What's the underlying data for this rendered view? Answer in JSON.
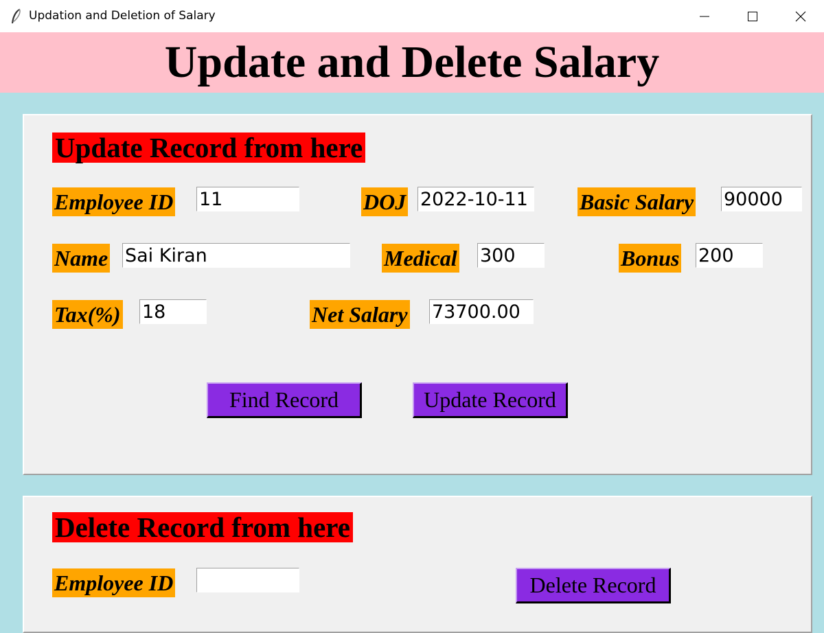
{
  "window": {
    "title": "Updation and Deletion of Salary"
  },
  "header": {
    "title": "Update and Delete Salary"
  },
  "update_section": {
    "title": "Update Record from here",
    "fields": {
      "employee_id": {
        "label": "Employee ID",
        "value": "11"
      },
      "doj": {
        "label": "DOJ",
        "value": "2022-10-11"
      },
      "basic_salary": {
        "label": "Basic Salary",
        "value": "90000"
      },
      "name": {
        "label": "Name",
        "value": "Sai Kiran"
      },
      "medical": {
        "label": "Medical",
        "value": "300"
      },
      "bonus": {
        "label": "Bonus",
        "value": "200"
      },
      "tax": {
        "label": "Tax(%)",
        "value": "18"
      },
      "net_salary": {
        "label": "Net Salary",
        "value": "73700.00"
      }
    },
    "buttons": {
      "find": "Find Record",
      "update": "Update Record"
    }
  },
  "delete_section": {
    "title": "Delete Record from here",
    "employee_id": {
      "label": "Employee ID",
      "value": ""
    },
    "buttons": {
      "delete": "Delete Record"
    }
  },
  "colors": {
    "background": "#b0dfe5",
    "banner": "#ffc0cb",
    "section_title": "#ff0000",
    "label": "#ffa500",
    "button": "#8a2be2",
    "panel": "#f0f0f0"
  },
  "icons": [
    "feather-icon",
    "minimize-icon",
    "maximize-icon",
    "close-icon"
  ]
}
